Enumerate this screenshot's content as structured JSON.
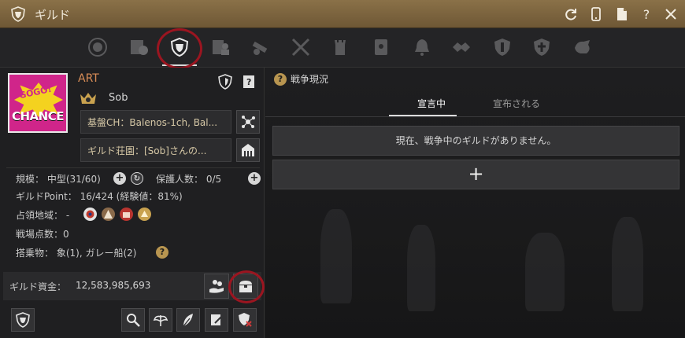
{
  "window": {
    "title": "ギルド",
    "buttons": [
      "refresh-icon",
      "phone-icon",
      "document-icon",
      "help-icon",
      "close-icon"
    ]
  },
  "tabs": [
    {
      "icon": "guild-emblem-icon",
      "active": false
    },
    {
      "icon": "guild-info-icon",
      "active": false
    },
    {
      "icon": "guild-shield-icon",
      "active": true
    },
    {
      "icon": "member-icon",
      "active": false
    },
    {
      "icon": "cannon-icon",
      "active": false
    },
    {
      "icon": "crossed-swords-icon",
      "active": false
    },
    {
      "icon": "tower-icon",
      "active": false
    },
    {
      "icon": "scroll-icon",
      "active": false
    },
    {
      "icon": "bell-icon",
      "active": false
    },
    {
      "icon": "battle-emblem-icon",
      "active": false
    },
    {
      "icon": "defense-shield-icon",
      "active": false
    },
    {
      "icon": "cross-shield-icon",
      "active": false
    },
    {
      "icon": "beast-icon",
      "active": false
    }
  ],
  "guild": {
    "name": "ART",
    "master": "Sob",
    "emblem_text_top": "GOGO!",
    "emblem_text_bottom": "CHANCE",
    "base_channel": "基盤CH：Balenos-1ch, Bal...",
    "manor": "ギルド荘園：[Sob]さんの...",
    "scale": "規模： 中型(31/60)",
    "protection": "保護人数： 0/5",
    "points": "ギルドPoint： 16/424 (経験値：81%)",
    "territory_label": "占領地域： -",
    "battle_points": "戦場点数：0",
    "mounts": "搭乗物： 象(1), ガレー船(2)",
    "funds_label": "ギルド資金：",
    "funds_value": "12,583,985,693"
  },
  "war": {
    "section_title": "戦争現況",
    "tab_declaring": "宣言中",
    "tab_declared": "宣布される",
    "empty_message": "現在、戦争中のギルドがありません。",
    "add_label": "+"
  },
  "colors": {
    "titlebar": "#7d6540",
    "accent_orange": "#d98d57",
    "highlight_ring": "#9b1520"
  }
}
